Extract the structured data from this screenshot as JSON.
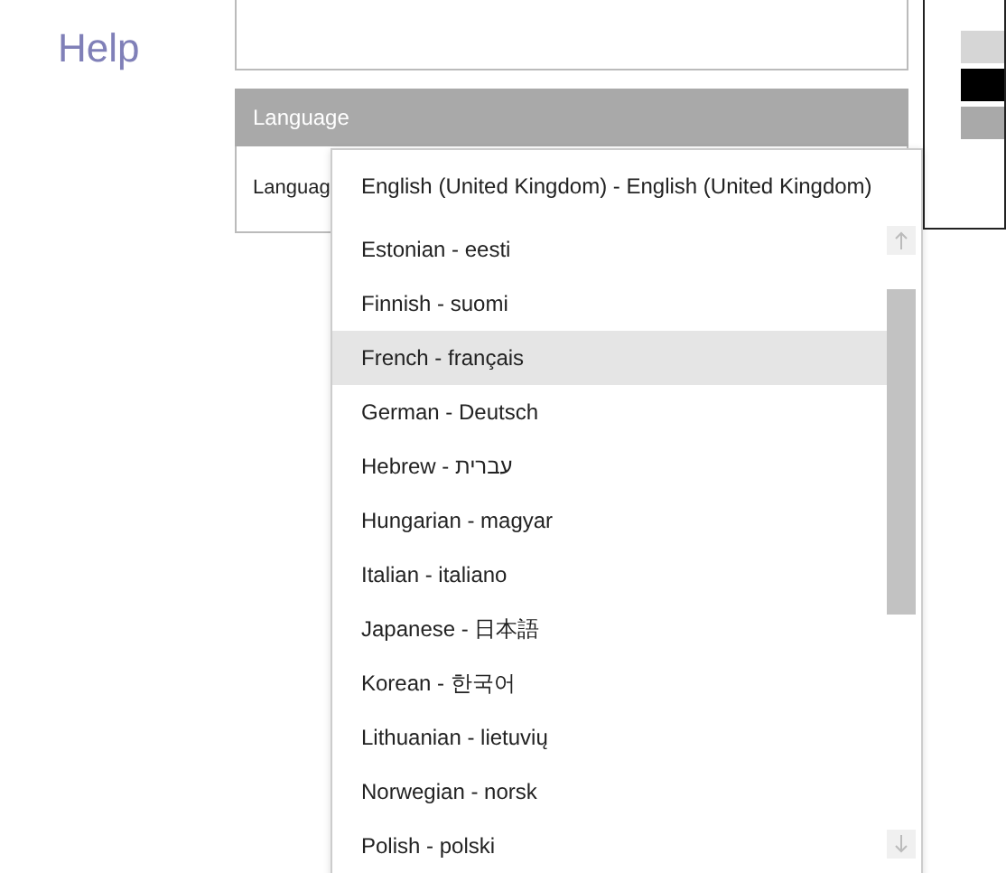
{
  "nav": {
    "help": "Help"
  },
  "language_panel": {
    "title": "Language",
    "label": "Languag"
  },
  "dropdown": {
    "current": "English (United Kingdom) - English (United Kingdom)",
    "items": [
      {
        "label": "Estonian - eesti",
        "selected": false
      },
      {
        "label": "Finnish - suomi",
        "selected": false
      },
      {
        "label": "French - français",
        "selected": true
      },
      {
        "label": "German - Deutsch",
        "selected": false
      },
      {
        "label": "Hebrew - עברית",
        "selected": false
      },
      {
        "label": "Hungarian - magyar",
        "selected": false
      },
      {
        "label": "Italian - italiano",
        "selected": false
      },
      {
        "label": "Japanese - 日本語",
        "selected": false
      },
      {
        "label": "Korean - 한국어",
        "selected": false
      },
      {
        "label": "Lithuanian - lietuvių",
        "selected": false
      },
      {
        "label": "Norwegian - norsk",
        "selected": false
      },
      {
        "label": "Polish - polski",
        "selected": false
      }
    ]
  }
}
